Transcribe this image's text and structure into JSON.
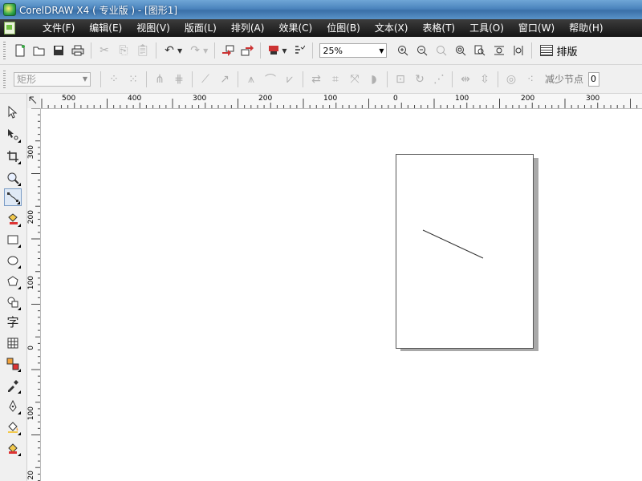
{
  "window": {
    "title": "CorelDRAW X4 ( 专业版 ) - [图形1]"
  },
  "menu": [
    "文件(F)",
    "编辑(E)",
    "视图(V)",
    "版面(L)",
    "排列(A)",
    "效果(C)",
    "位图(B)",
    "文本(X)",
    "表格(T)",
    "工具(O)",
    "窗口(W)",
    "帮助(H)"
  ],
  "toolbar": {
    "zoom_value": "25%",
    "layout_label": "排版"
  },
  "property_bar": {
    "object_type": "矩形",
    "reduce_nodes_label": "减少节点",
    "reduce_nodes_value": "0"
  },
  "ruler": {
    "horizontal_ticks": [
      "500",
      "400",
      "300",
      "200",
      "100",
      "0",
      "100",
      "200",
      "300"
    ],
    "vertical_ticks": [
      "300",
      "200",
      "100",
      "0",
      "100",
      "20"
    ]
  },
  "toolbox": {
    "text_tool_label": "字",
    "active_tool": "freehand-tool"
  }
}
